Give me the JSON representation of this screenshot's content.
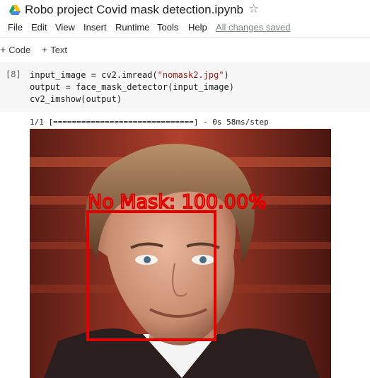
{
  "notebook": {
    "title": "Robo project Covid mask detection.ipynb",
    "icons": {
      "drive": "google-drive-icon",
      "star": "star-outline-icon"
    }
  },
  "menu": {
    "items": [
      "File",
      "Edit",
      "View",
      "Insert",
      "Runtime",
      "Tools",
      "Help"
    ],
    "save_status": "All changes saved"
  },
  "toolbar": {
    "code_label": "Code",
    "text_label": "Text"
  },
  "cell": {
    "exec_count": "[8]",
    "code_lines": [
      {
        "pre": "input_image = cv2.imread(",
        "str": "\"nomask2.jpg\"",
        "post": ")"
      },
      {
        "pre": "output = face_mask_detector(input_image)",
        "str": "",
        "post": ""
      },
      {
        "pre": "cv2_imshow(output)",
        "str": "",
        "post": ""
      }
    ]
  },
  "output": {
    "progress_text": "1/1 [==============================] - 0s 58ms/step",
    "detection_label": "No Mask: 100.00%",
    "box_color": "#e00000"
  }
}
